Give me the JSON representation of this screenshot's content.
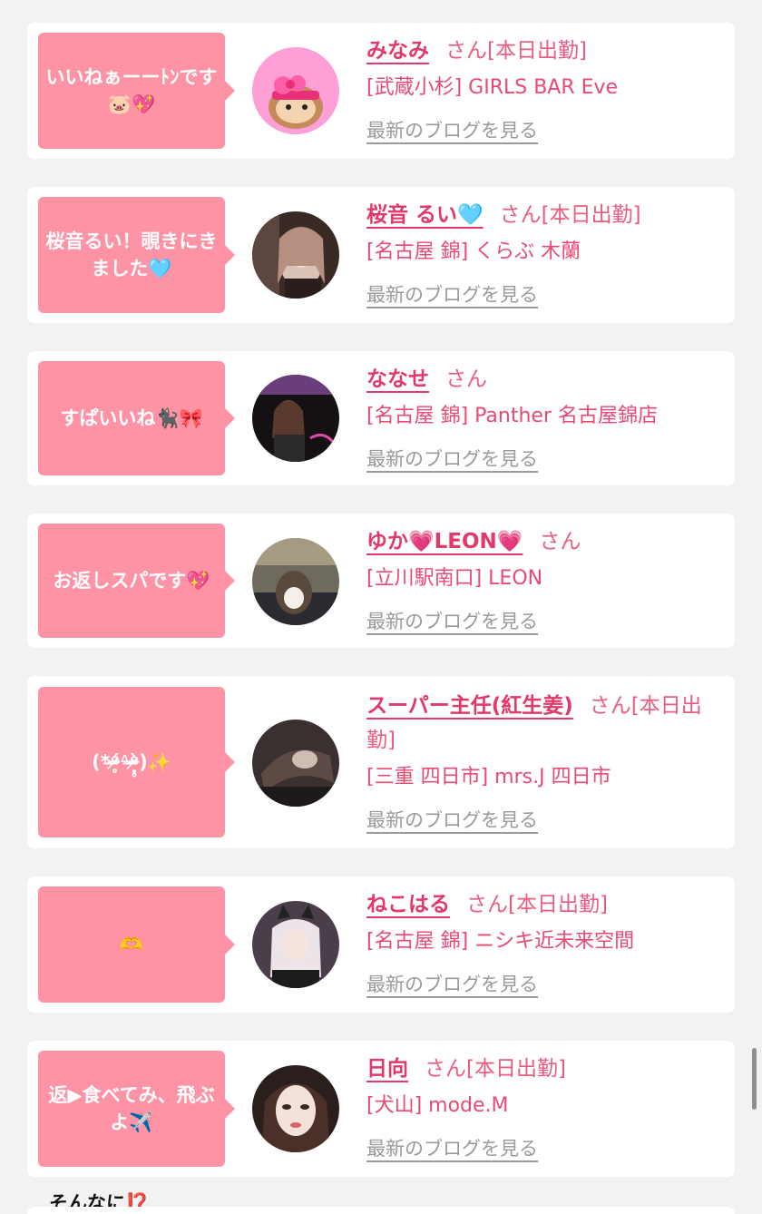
{
  "entries": [
    {
      "comment": "いいねぁーーﾄﾝです🐷💖",
      "name": "みなみ",
      "suffix": "さん[本日出勤]",
      "shop": "[武蔵小杉] GIRLS BAR Eve",
      "blog": "最新のブログを見る"
    },
    {
      "comment": "桜音るい！覗きにきました🩵",
      "name": "桜音 るい🩵",
      "suffix": "さん[本日出勤]",
      "shop": "[名古屋 錦] くらぶ 木蘭",
      "blog": "最新のブログを見る"
    },
    {
      "comment": "すぱいいね🐈‍⬛🎀",
      "name": "ななせ",
      "suffix": "さん",
      "shop": "[名古屋 錦] Panther 名古屋錦店",
      "blog": "最新のブログを見る"
    },
    {
      "comment": "お返しスパです💖",
      "name": "ゆか💗LEON💗",
      "suffix": "さん",
      "shop": "[立川駅南口] LEON",
      "blog": "最新のブログを見る"
    },
    {
      "comment": "(*ᵒ̴̶̷̥́ᐞᵒ̴̶̷̣̥̀)✨",
      "name": "スーパー主任(紅生姜)",
      "suffix": "さん[本日出勤]",
      "shop": "[三重 四日市] mrs.J 四日市",
      "blog": "最新のブログを見る"
    },
    {
      "comment": "🫶",
      "name": "ねこはる",
      "suffix": "さん[本日出勤]",
      "shop": "[名古屋 錦] ニシキ近未来空間",
      "blog": "最新のブログを見る"
    },
    {
      "comment": "返▶食べてみ、飛ぶよ✈️",
      "name": "日向",
      "suffix": "さん[本日出勤]",
      "shop": "[犬山] mode.M",
      "blog": "最新のブログを見る"
    }
  ],
  "footer": {
    "title": "そんなに⁉️"
  },
  "colors": {
    "bubble": "#ff93a6",
    "name": "#e0396a",
    "text": "#e94a73",
    "blog": "#9a9a9a",
    "background": "#f2f2f2"
  }
}
